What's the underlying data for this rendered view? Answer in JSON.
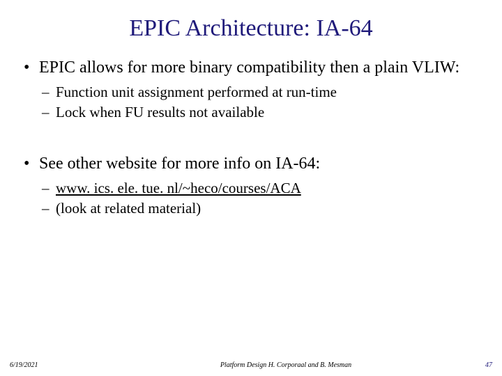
{
  "title": "EPIC Architecture: IA-64",
  "bullets": {
    "b1": {
      "text": "EPIC allows for more binary compatibility then a plain VLIW:",
      "sub1": "Function unit assignment performed at run-time",
      "sub2": "Lock when FU results not available"
    },
    "b2": {
      "text": "See other website for more info on IA-64:",
      "sub1": "www. ics. ele. tue. nl/~heco/courses/ACA",
      "sub2": "(look at related material)"
    }
  },
  "footer": {
    "date": "6/19/2021",
    "center": "Platform Design     H. Corporaal and B. Mesman",
    "page": "47"
  }
}
